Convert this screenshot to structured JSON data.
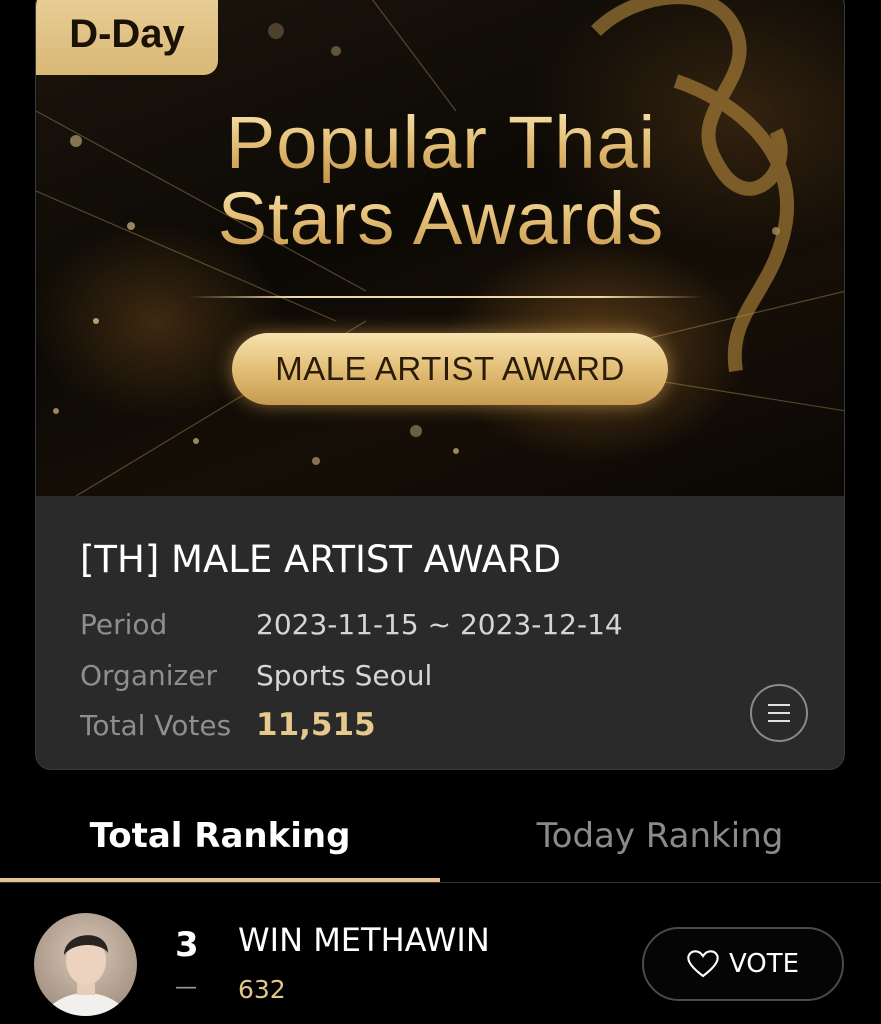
{
  "banner": {
    "badge": "D-Day",
    "title_line1": "Popular Thai",
    "title_line2": "Stars Awards",
    "pill_label": "MALE ARTIST AWARD"
  },
  "award": {
    "title": "[TH] MALE ARTIST AWARD",
    "period_label": "Period",
    "period_value": "2023-11-15 ~ 2023-12-14",
    "organizer_label": "Organizer",
    "organizer_value": "Sports Seoul",
    "total_votes_label": "Total Votes",
    "total_votes_value": "11,515",
    "menu_icon": "menu-icon"
  },
  "tabs": [
    {
      "label": "Total Ranking",
      "active": true
    },
    {
      "label": "Today Ranking",
      "active": false
    }
  ],
  "ranking": [
    {
      "rank": "3",
      "change": "—",
      "name": "WIN METHAWIN",
      "votes": "632",
      "vote_button": "VOTE",
      "vote_icon": "heart-icon"
    }
  ],
  "colors": {
    "accent_gold": "#e3c68d",
    "background": "#000000",
    "card": "#2a2a2a"
  }
}
